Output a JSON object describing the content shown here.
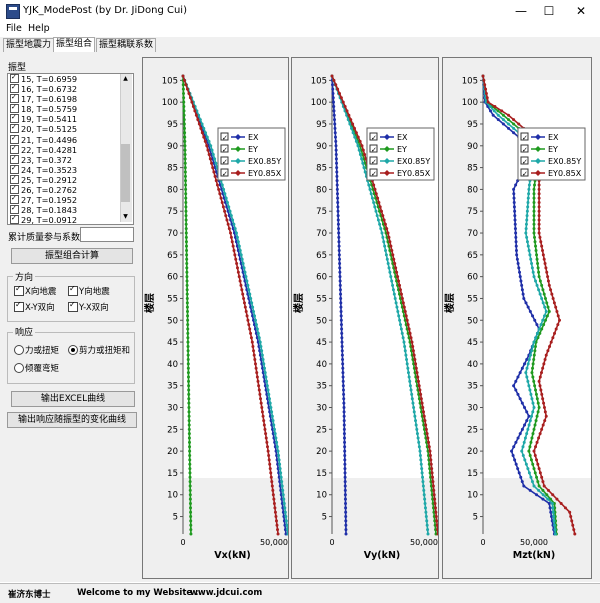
{
  "window": {
    "title": "YJK_ModePost (by Dr. JiDong Cui)",
    "controls": {
      "minimize": "—",
      "maximize": "☐",
      "close": "✕"
    }
  },
  "menu": [
    "File",
    "Help"
  ],
  "tabs": [
    "振型地震力",
    "振型组合",
    "振型耦联系数"
  ],
  "active_tab": 1,
  "left": {
    "modes_label": "振型",
    "mode_list": [
      "15, T=0.6959",
      "16, T=0.6732",
      "17, T=0.6198",
      "18, T=0.5759",
      "19, T=0.5411",
      "20, T=0.5125",
      "21, T=0.4496",
      "22, T=0.4281",
      "23, T=0.372",
      "24, T=0.3523",
      "25, T=0.2912",
      "26, T=0.2762",
      "27, T=0.1952",
      "28, T=0.1843",
      "29, T=0.0912",
      "30, T=0.0865"
    ],
    "mass_label": "累计质量参与系数",
    "mass_value": "",
    "combine_button": "振型组合计算",
    "direction": {
      "title": "方向",
      "options": [
        "X向地震",
        "Y向地震",
        "X-Y双向",
        "Y-X双向"
      ]
    },
    "response": {
      "title": "响应",
      "options": [
        "力或扭矩",
        "剪力或扭矩和",
        "倾覆弯矩"
      ],
      "selected": 1
    },
    "excel_button": "输出EXCEL曲线",
    "curve_button": "输出响应随振型的变化曲线"
  },
  "colors": {
    "EX": "#1f2fa8",
    "EY": "#1f9a1f",
    "EX085Y": "#1fa8a8",
    "EY085X": "#a81f1f"
  },
  "chart_data": [
    {
      "type": "line",
      "xlabel": "Vx(kN)",
      "ylabel": "楼层",
      "x_ticks": [
        "0",
        "50,000"
      ],
      "y_ticks": [
        5,
        10,
        15,
        20,
        25,
        30,
        35,
        40,
        45,
        50,
        55,
        60,
        65,
        70,
        75,
        80,
        85,
        90,
        95,
        100,
        105
      ],
      "xlim": [
        0,
        50000
      ],
      "ylim": [
        1,
        106
      ],
      "legend": [
        "EX",
        "EY",
        "EX0.85Y",
        "EY0.85X"
      ],
      "series": [
        {
          "name": "EX",
          "points": [
            [
              0,
              106
            ],
            [
              13000,
              90
            ],
            [
              26000,
              70
            ],
            [
              38000,
              45
            ],
            [
              47000,
              20
            ],
            [
              52000,
              1
            ]
          ]
        },
        {
          "name": "EY",
          "points": [
            [
              0,
              106
            ],
            [
              1000,
              90
            ],
            [
              2000,
              60
            ],
            [
              3000,
              30
            ],
            [
              4000,
              1
            ]
          ]
        },
        {
          "name": "EX0.85Y",
          "points": [
            [
              0,
              106
            ],
            [
              14000,
              90
            ],
            [
              27000,
              70
            ],
            [
              39000,
              45
            ],
            [
              48000,
              20
            ],
            [
              53000,
              1
            ]
          ]
        },
        {
          "name": "EY0.85X",
          "points": [
            [
              0,
              106
            ],
            [
              12000,
              90
            ],
            [
              24000,
              70
            ],
            [
              35000,
              45
            ],
            [
              43000,
              20
            ],
            [
              48000,
              1
            ]
          ]
        }
      ]
    },
    {
      "type": "line",
      "xlabel": "Vy(kN)",
      "ylabel": "楼层",
      "x_ticks": [
        "0",
        "50,000"
      ],
      "y_ticks": [
        5,
        10,
        15,
        20,
        25,
        30,
        35,
        40,
        45,
        50,
        55,
        60,
        65,
        70,
        75,
        80,
        85,
        90,
        95,
        100,
        105
      ],
      "xlim": [
        0,
        50000
      ],
      "ylim": [
        1,
        106
      ],
      "legend": [
        "EX",
        "EY",
        "EX0.85Y",
        "EY0.85X"
      ],
      "series": [
        {
          "name": "EX",
          "points": [
            [
              0,
              106
            ],
            [
              2000,
              90
            ],
            [
              4000,
              60
            ],
            [
              6000,
              30
            ],
            [
              7000,
              1
            ]
          ]
        },
        {
          "name": "EY",
          "points": [
            [
              0,
              106
            ],
            [
              14000,
              90
            ],
            [
              27000,
              70
            ],
            [
              39000,
              45
            ],
            [
              48000,
              20
            ],
            [
              52000,
              1
            ]
          ]
        },
        {
          "name": "EX0.85Y",
          "points": [
            [
              0,
              106
            ],
            [
              13000,
              90
            ],
            [
              25000,
              70
            ],
            [
              36000,
              45
            ],
            [
              44000,
              20
            ],
            [
              48000,
              1
            ]
          ]
        },
        {
          "name": "EY0.85X",
          "points": [
            [
              0,
              106
            ],
            [
              15000,
              90
            ],
            [
              28000,
              70
            ],
            [
              40000,
              45
            ],
            [
              49000,
              20
            ],
            [
              53000,
              1
            ]
          ]
        }
      ]
    },
    {
      "type": "line",
      "xlabel": "Mzt(kN)",
      "ylabel": "楼层",
      "x_ticks": [
        "0",
        "50,000"
      ],
      "y_ticks": [
        5,
        10,
        15,
        20,
        25,
        30,
        35,
        40,
        45,
        50,
        55,
        60,
        65,
        70,
        75,
        80,
        85,
        90,
        95,
        100,
        105
      ],
      "xlim": [
        0,
        100000
      ],
      "ylim": [
        1,
        106
      ],
      "legend": [
        "EX",
        "EY",
        "EX0.85Y",
        "EY0.85X"
      ],
      "series": [
        {
          "name": "EX",
          "points": [
            [
              0,
              106
            ],
            [
              2000,
              100
            ],
            [
              10000,
              97
            ],
            [
              45000,
              90
            ],
            [
              40000,
              85
            ],
            [
              30000,
              80
            ],
            [
              32000,
              70
            ],
            [
              33000,
              65
            ],
            [
              40000,
              55
            ],
            [
              55000,
              48
            ],
            [
              45000,
              42
            ],
            [
              30000,
              35
            ],
            [
              45000,
              28
            ],
            [
              28000,
              20
            ],
            [
              40000,
              12
            ],
            [
              65000,
              8
            ],
            [
              70000,
              1
            ]
          ]
        },
        {
          "name": "EY",
          "points": [
            [
              0,
              106
            ],
            [
              4000,
              100
            ],
            [
              20000,
              97
            ],
            [
              55000,
              90
            ],
            [
              50000,
              80
            ],
            [
              50000,
              70
            ],
            [
              55000,
              60
            ],
            [
              65000,
              52
            ],
            [
              52000,
              45
            ],
            [
              48000,
              38
            ],
            [
              55000,
              30
            ],
            [
              45000,
              20
            ],
            [
              55000,
              12
            ],
            [
              70000,
              8
            ],
            [
              72000,
              1
            ]
          ]
        },
        {
          "name": "EX0.85Y",
          "points": [
            [
              0,
              106
            ],
            [
              3000,
              100
            ],
            [
              15000,
              97
            ],
            [
              50000,
              90
            ],
            [
              45000,
              80
            ],
            [
              42000,
              70
            ],
            [
              50000,
              60
            ],
            [
              62000,
              52
            ],
            [
              50000,
              45
            ],
            [
              42000,
              38
            ],
            [
              50000,
              30
            ],
            [
              38000,
              20
            ],
            [
              50000,
              12
            ],
            [
              68000,
              8
            ],
            [
              71000,
              1
            ]
          ]
        },
        {
          "name": "EY0.85X",
          "points": [
            [
              0,
              106
            ],
            [
              5000,
              100
            ],
            [
              25000,
              97
            ],
            [
              60000,
              90
            ],
            [
              55000,
              82
            ],
            [
              55000,
              70
            ],
            [
              65000,
              58
            ],
            [
              75000,
              50
            ],
            [
              62000,
              42
            ],
            [
              55000,
              36
            ],
            [
              62000,
              28
            ],
            [
              50000,
              20
            ],
            [
              60000,
              12
            ],
            [
              85000,
              6
            ],
            [
              90000,
              1
            ]
          ]
        }
      ]
    }
  ],
  "status": {
    "author": "崔济东博士",
    "welcome": "Welcome to my Website :",
    "site": "www.jdcui.com"
  }
}
